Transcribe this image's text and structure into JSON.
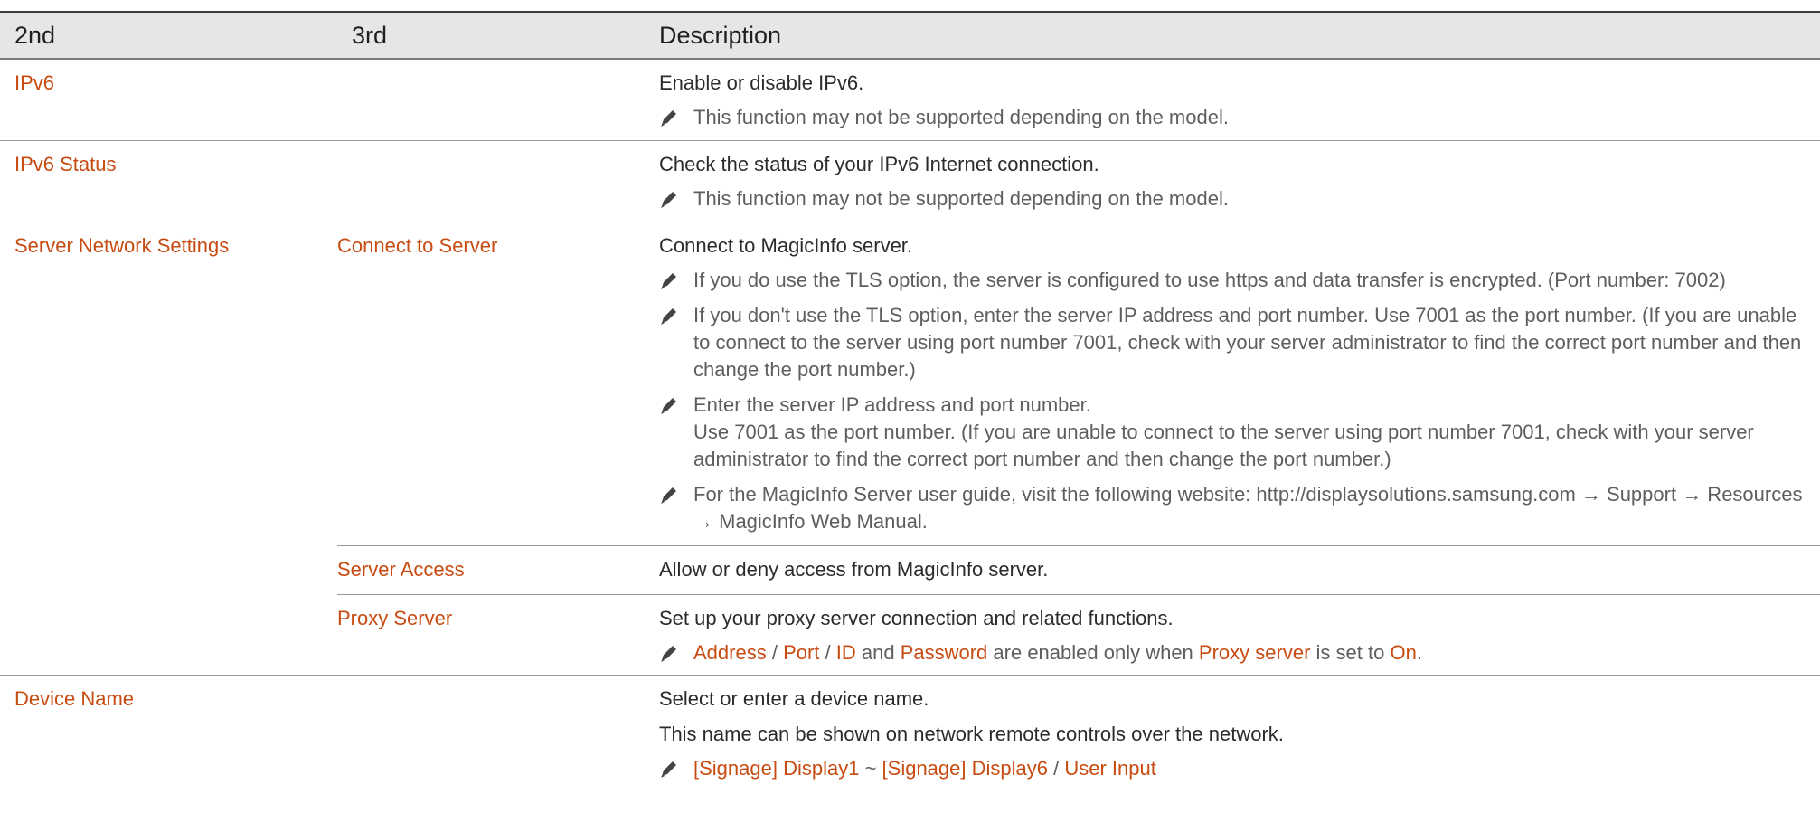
{
  "header": {
    "col1": "2nd",
    "col2": "3rd",
    "col3": "Description"
  },
  "ipv6": {
    "label": "IPv6",
    "desc": "Enable or disable IPv6.",
    "note": "This function may not be supported depending on the model."
  },
  "ipv6_status": {
    "label": "IPv6 Status",
    "desc": "Check the status of your IPv6 Internet connection.",
    "note": "This function may not be supported depending on the model."
  },
  "server_network": {
    "label": "Server Network Settings",
    "connect": {
      "label": "Connect to Server",
      "desc": "Connect to MagicInfo server.",
      "note1": "If you do use the TLS option, the server is configured to use https and data transfer is encrypted. (Port number: 7002)",
      "note2": "If you don't use the TLS option, enter the server IP address and port number. Use 7001 as the port number. (If you are unable to connect to the server using port number 7001, check with your server administrator to find the correct port number and then change the port number.)",
      "note3_line1": "Enter the server IP address and port number.",
      "note3_line2": "Use 7001 as the port number. (If you are unable to connect to the server using port number 7001, check with your server administrator to find the correct port number and then change the port number.)",
      "note4": "For the MagicInfo Server user guide, visit the following website: http://displaysolutions.samsung.com → Support → Resources → MagicInfo Web Manual."
    },
    "access": {
      "label": "Server Access",
      "desc": "Allow or deny access from MagicInfo server."
    },
    "proxy": {
      "label": "Proxy Server",
      "desc": "Set up your proxy server connection and related functions.",
      "note": {
        "address": "Address",
        "slash1": " / ",
        "port": "Port",
        "slash2": " / ",
        "id": "ID",
        "and": " and ",
        "password": "Password",
        "mid": " are enabled only when ",
        "proxy_server": "Proxy server",
        "is_set": " is set to ",
        "on": "On",
        "end": "."
      }
    }
  },
  "device_name": {
    "label": "Device Name",
    "desc1": "Select or enter a device name.",
    "desc2": "This name can be shown on network remote controls over the network.",
    "note": {
      "display1": "[Signage] Display1",
      "tilde": " ~ ",
      "display6": "[Signage] Display6",
      "slash": " / ",
      "user_input": "User Input"
    }
  },
  "colors": {
    "accent": "#c84b11",
    "text": "#2b2b2b",
    "note_text": "#5e5e5e",
    "header_bg": "#e6e6e6"
  },
  "icons": {
    "note": "pencil-note-icon"
  }
}
